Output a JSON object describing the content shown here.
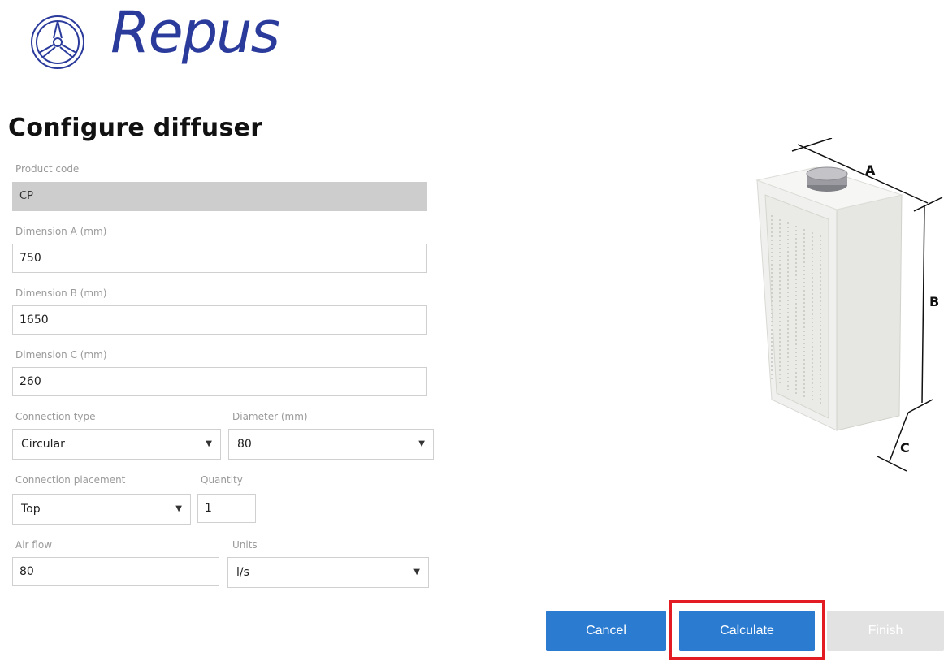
{
  "brand": {
    "name": "Repus",
    "color": "#2b3b9c"
  },
  "page": {
    "title": "Configure diffuser"
  },
  "form": {
    "product_code": {
      "label": "Product code",
      "value": "CP"
    },
    "dim_a": {
      "label": "Dimension A (mm)",
      "value": "750"
    },
    "dim_b": {
      "label": "Dimension B (mm)",
      "value": "1650"
    },
    "dim_c": {
      "label": "Dimension C (mm)",
      "value": "260"
    },
    "connection_type": {
      "label": "Connection type",
      "value": "Circular"
    },
    "diameter": {
      "label": "Diameter (mm)",
      "value": "80"
    },
    "connection_placement": {
      "label": "Connection placement",
      "value": "Top"
    },
    "quantity": {
      "label": "Quantity",
      "value": "1"
    },
    "air_flow": {
      "label": "Air flow",
      "value": "80"
    },
    "units": {
      "label": "Units",
      "value": "l/s"
    }
  },
  "diagram": {
    "label_a": "A",
    "label_b": "B",
    "label_c": "C"
  },
  "actions": {
    "cancel": "Cancel",
    "calculate": "Calculate",
    "finish": "Finish",
    "accent": "#2b7bd1",
    "highlight_color": "#e31b23"
  },
  "icons": {
    "dropdown": "chevron-down-icon",
    "logo": "repus-wheel-logo-icon"
  }
}
